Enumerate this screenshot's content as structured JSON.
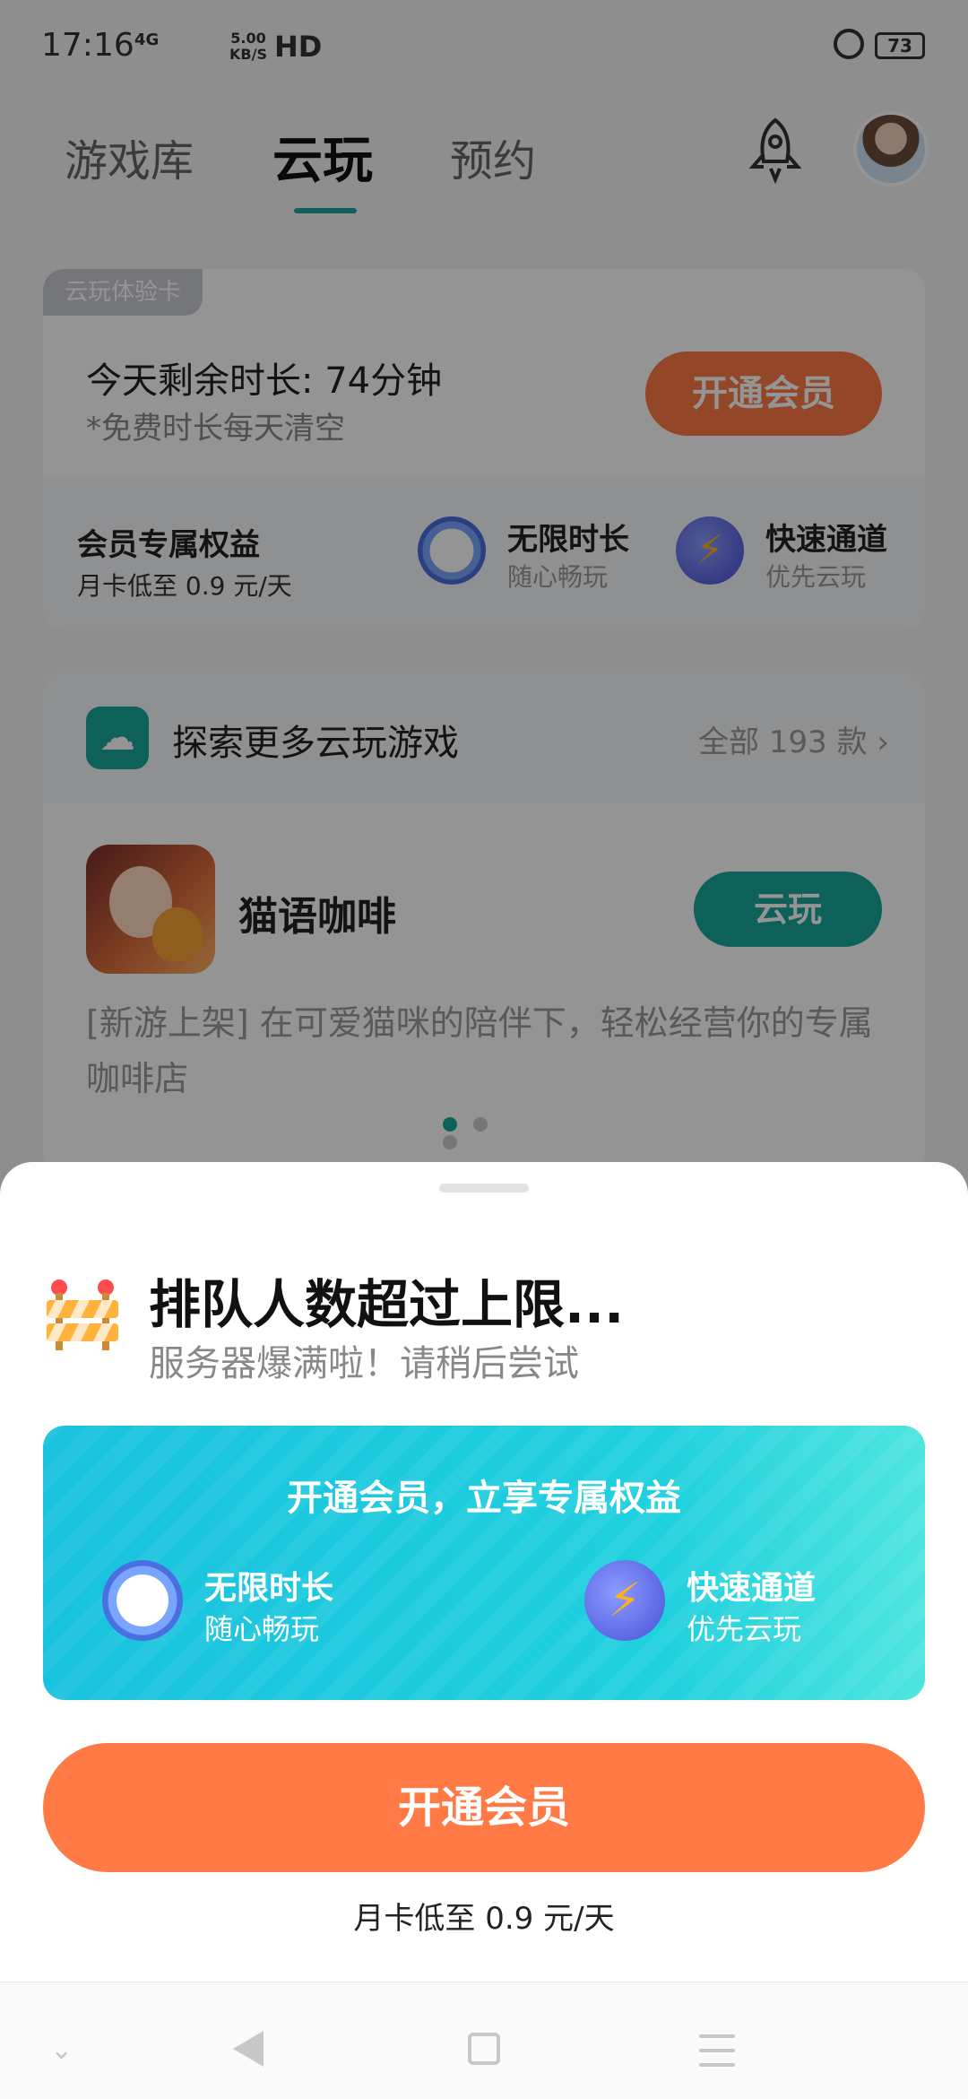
{
  "status_bar": {
    "time": "17:16",
    "network": "4G",
    "speed_value": "5.00",
    "speed_unit": "KB/S",
    "hd": "HD",
    "battery": "73"
  },
  "tabs": [
    {
      "label": "游戏库",
      "active": false
    },
    {
      "label": "云玩",
      "active": true
    },
    {
      "label": "预约",
      "active": false
    }
  ],
  "trial_card": {
    "tag": "云玩体验卡",
    "remaining": "今天剩余时长: 74分钟",
    "remaining_note": "*免费时长每天清空",
    "open_button": "开通会员",
    "benefits_title": "会员专属权益",
    "price_note": "月卡低至 0.9 元/天",
    "benefits": [
      {
        "icon": "clock-icon",
        "title": "无限时长",
        "sub": "随心畅玩"
      },
      {
        "icon": "lightning-icon",
        "title": "快速通道",
        "sub": "优先云玩"
      }
    ]
  },
  "explore_card": {
    "title": "探索更多云玩游戏",
    "all_label": "全部 193 款",
    "game": {
      "name": "猫语咖啡",
      "button": "云玩",
      "desc": "[新游上架] 在可爱猫咪的陪伴下，轻松经营你的专属咖啡店"
    },
    "carousel_pages": 3,
    "carousel_active": 1
  },
  "sheet": {
    "title": "排队人数超过上限...",
    "subtitle": "服务器爆满啦！请稍后尝试",
    "promo_title": "开通会员，立享专属权益",
    "promo_benefits": [
      {
        "icon": "clock-icon",
        "title": "无限时长",
        "sub": "随心畅玩"
      },
      {
        "icon": "lightning-icon",
        "title": "快速通道",
        "sub": "优先云玩"
      }
    ],
    "open_button": "开通会员",
    "price_note": "月卡低至 0.9 元/天"
  },
  "colors": {
    "accent_teal": "#19a89a",
    "accent_orange": "#ff7a45",
    "promo_cyan": "#1fd0de"
  }
}
